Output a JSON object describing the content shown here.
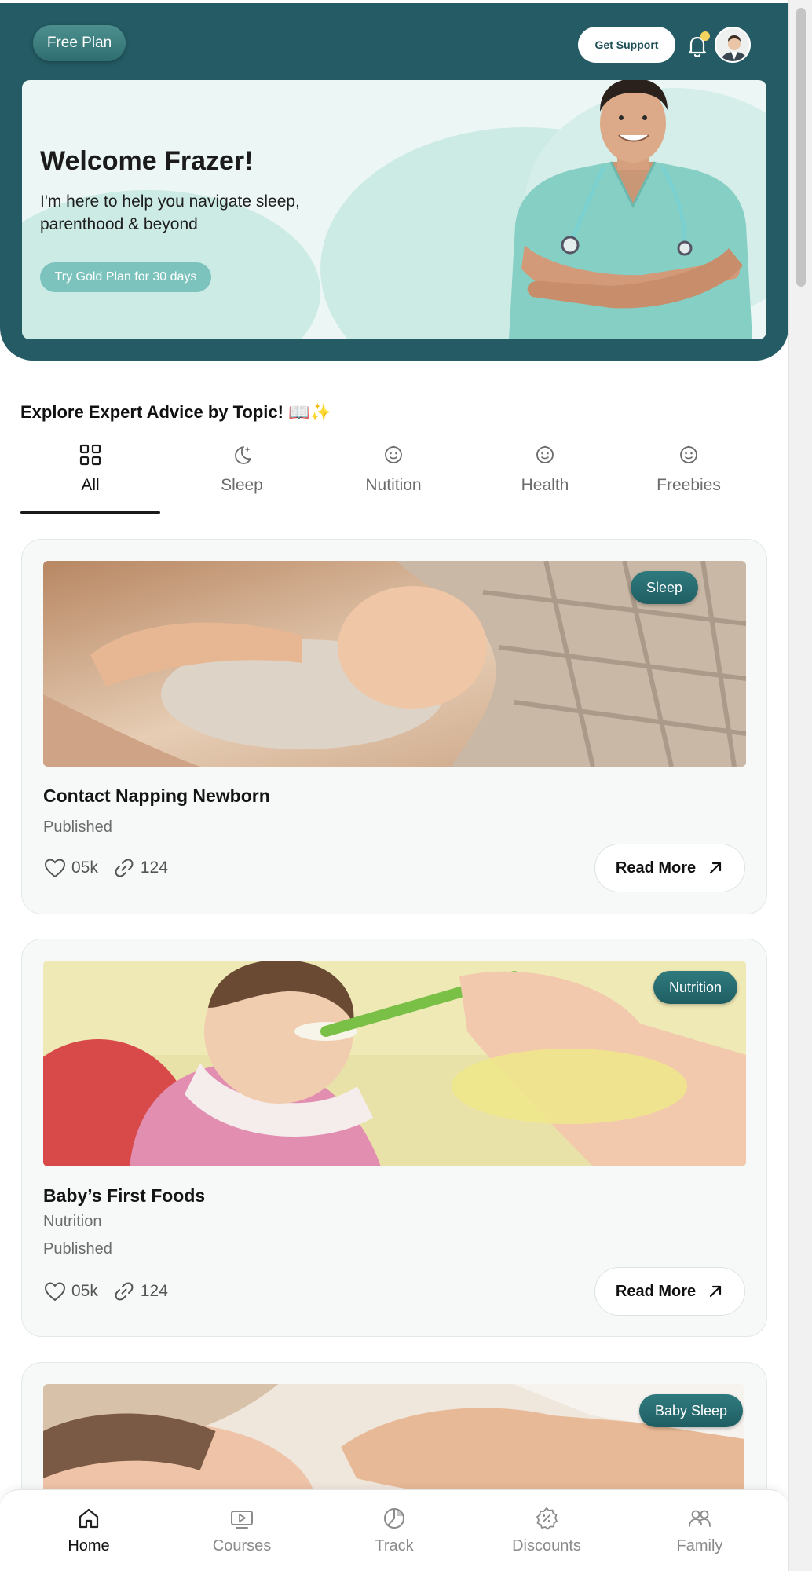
{
  "header": {
    "plan_label": "Free Plan",
    "support_label": "Get Support"
  },
  "hero": {
    "title": "Welcome Frazer!",
    "subtitle": "I'm here to help you navigate sleep, parenthood & beyond",
    "cta_label": "Try Gold Plan for 30 days"
  },
  "section": {
    "title": "Explore Expert Advice by Topic! 📖✨"
  },
  "tabs": [
    {
      "label": "All",
      "icon": "grid-icon",
      "active": true
    },
    {
      "label": "Sleep",
      "icon": "moon-icon",
      "active": false
    },
    {
      "label": "Nutition",
      "icon": "smiley-icon",
      "active": false
    },
    {
      "label": "Health",
      "icon": "smiley-icon",
      "active": false
    },
    {
      "label": "Freebies",
      "icon": "smiley-icon",
      "active": false
    }
  ],
  "cards": [
    {
      "tag": "Sleep",
      "title": "Contact Napping Newborn",
      "category": "",
      "status": "Published",
      "likes": "05k",
      "shares": "124",
      "read_label": "Read More"
    },
    {
      "tag": "Nutrition",
      "title": "Baby’s First Foods",
      "category": "Nutrition",
      "status": "Published",
      "likes": "05k",
      "shares": "124",
      "read_label": "Read More"
    },
    {
      "tag": "Baby Sleep"
    }
  ],
  "bottom_nav": [
    {
      "label": "Home",
      "icon": "home-icon",
      "active": true
    },
    {
      "label": "Courses",
      "icon": "play-icon",
      "active": false
    },
    {
      "label": "Track",
      "icon": "chart-icon",
      "active": false
    },
    {
      "label": "Discounts",
      "icon": "discount-icon",
      "active": false
    },
    {
      "label": "Family",
      "icon": "family-icon",
      "active": false
    }
  ],
  "colors": {
    "header_bg": "#245b64",
    "accent": "#7cc3bd",
    "tag_bg": "#1f5e63"
  }
}
